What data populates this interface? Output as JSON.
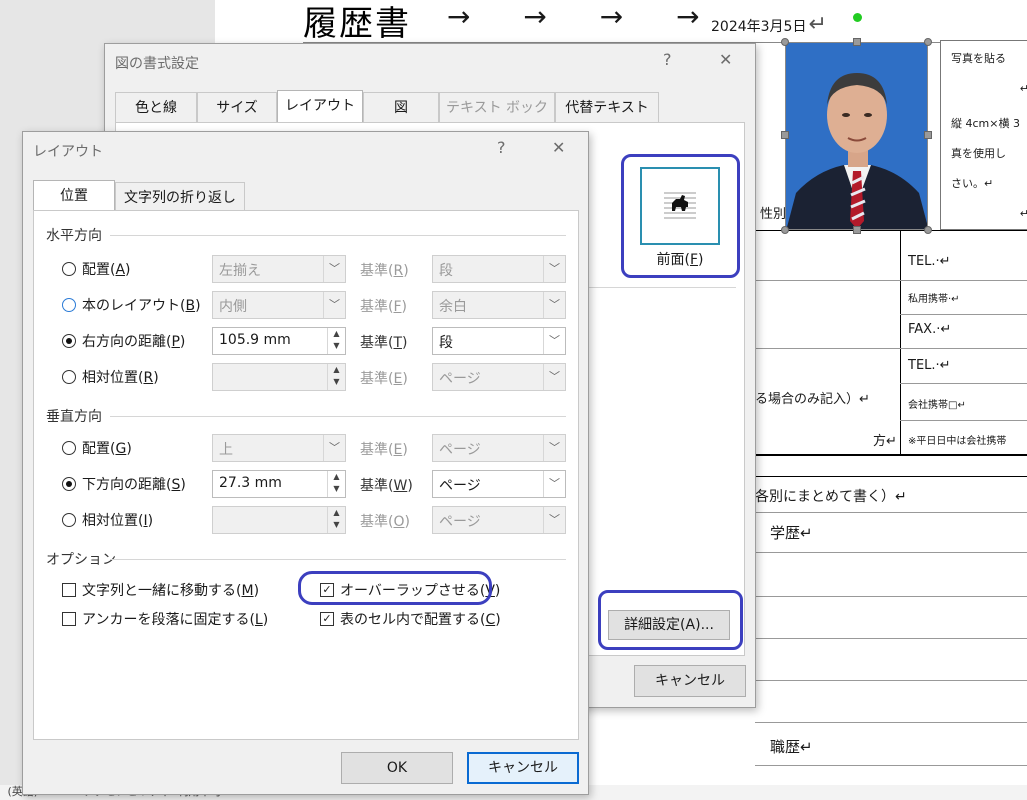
{
  "document": {
    "title": "履歴書",
    "arrows": "→ → → →",
    "date": "2024年3月5日",
    "return_mark": "↵",
    "photo_note": [
      "写真を貼る",
      "↵",
      "縦 4cm×横 3",
      "真を使用し",
      "さい。↵",
      "↵"
    ],
    "gender_label": "性別",
    "tel1": "TEL.·↵",
    "mobile_private": "私用携帯·↵",
    "fax": "FAX.·↵",
    "tel2": "TEL.·↵",
    "note_only": "る場合のみ記入）↵",
    "mobile_company": "会社携帯□↵",
    "kata": "方↵",
    "weekday_note": "※平日日中は会社携帯",
    "history_note": "各別にまとめて書く）↵",
    "education": "学歴↵",
    "career": "職歴↵"
  },
  "format_dialog": {
    "title": "図の書式設定",
    "help": "?",
    "close": "✕",
    "tabs": [
      "色と線",
      "サイズ",
      "レイアウト",
      "図",
      "テキスト ボックス",
      "代替テキスト"
    ],
    "front_label": "前面(F)",
    "front_key": "F",
    "advanced_button": "詳細設定(A)...",
    "cancel_button": "キャンセル"
  },
  "layout_dialog": {
    "title": "レイアウト",
    "help": "?",
    "close": "✕",
    "tabs": [
      "位置",
      "文字列の折り返し"
    ],
    "horizontal": {
      "heading": "水平方向",
      "rows": [
        {
          "label": "配置",
          "key": "A",
          "checked": false,
          "value": "左揃え",
          "base_label": "基準",
          "base_key": "R",
          "base_value": "段",
          "enabled": false
        },
        {
          "label": "本のレイアウト",
          "key": "B",
          "checked": false,
          "value": "内側",
          "base_label": "基準",
          "base_key": "F",
          "base_value": "余白",
          "enabled": false
        },
        {
          "label": "右方向の距離",
          "key": "P",
          "checked": true,
          "value": "105.9 mm",
          "base_label": "基準",
          "base_key": "T",
          "base_value": "段",
          "enabled": true
        },
        {
          "label": "相対位置",
          "key": "R",
          "checked": false,
          "value": "",
          "base_label": "基準",
          "base_key": "E",
          "base_value": "ページ",
          "enabled": false
        }
      ]
    },
    "vertical": {
      "heading": "垂直方向",
      "rows": [
        {
          "label": "配置",
          "key": "G",
          "checked": false,
          "value": "上",
          "base_label": "基準",
          "base_key": "E",
          "base_value": "ページ",
          "enabled": false
        },
        {
          "label": "下方向の距離",
          "key": "S",
          "checked": true,
          "value": "27.3 mm",
          "base_label": "基準",
          "base_key": "W",
          "base_value": "ページ",
          "enabled": true
        },
        {
          "label": "相対位置",
          "key": "I",
          "checked": false,
          "value": "",
          "base_label": "基準",
          "base_key": "O",
          "base_value": "ページ",
          "enabled": false
        }
      ]
    },
    "options": {
      "heading": "オプション",
      "move_with_text": {
        "label": "文字列と一緒に移動する",
        "key": "M",
        "checked": false
      },
      "lock_anchor": {
        "label": "アンカーを段落に固定する",
        "key": "L",
        "checked": false
      },
      "allow_overlap": {
        "label": "オーバーラップさせる",
        "key": "V",
        "checked": true
      },
      "layout_in_cell": {
        "label": "表のセル内で配置する",
        "key": "C",
        "checked": true
      }
    },
    "ok_button": "OK",
    "cancel_button": "キャンセル"
  },
  "status_bar": " (英語)             アクセシビリティ: 利用不可",
  "colors": {
    "highlight": "#3c3fbf",
    "photo_bg": "#2f6fc5",
    "accent": "#0a6ad2"
  }
}
